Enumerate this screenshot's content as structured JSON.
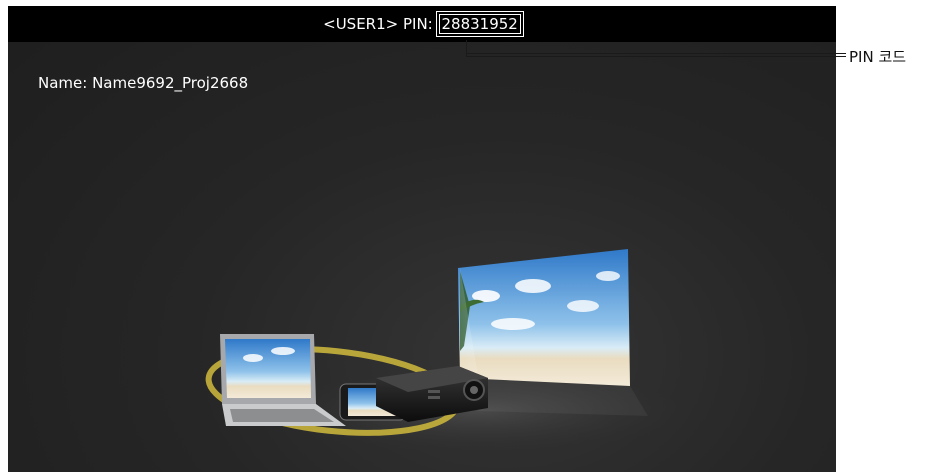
{
  "header": {
    "user_prefix": "<USER1> PIN: ",
    "pin_code": "28831952"
  },
  "info": {
    "name_line": "Name: Name9692_Proj2668"
  },
  "callout": {
    "label": "PIN 코드"
  },
  "illustration": {
    "devices": [
      "laptop-icon",
      "smartphone-icon",
      "projector-icon",
      "projection-screen"
    ],
    "ring_color": "#c8b43c"
  }
}
